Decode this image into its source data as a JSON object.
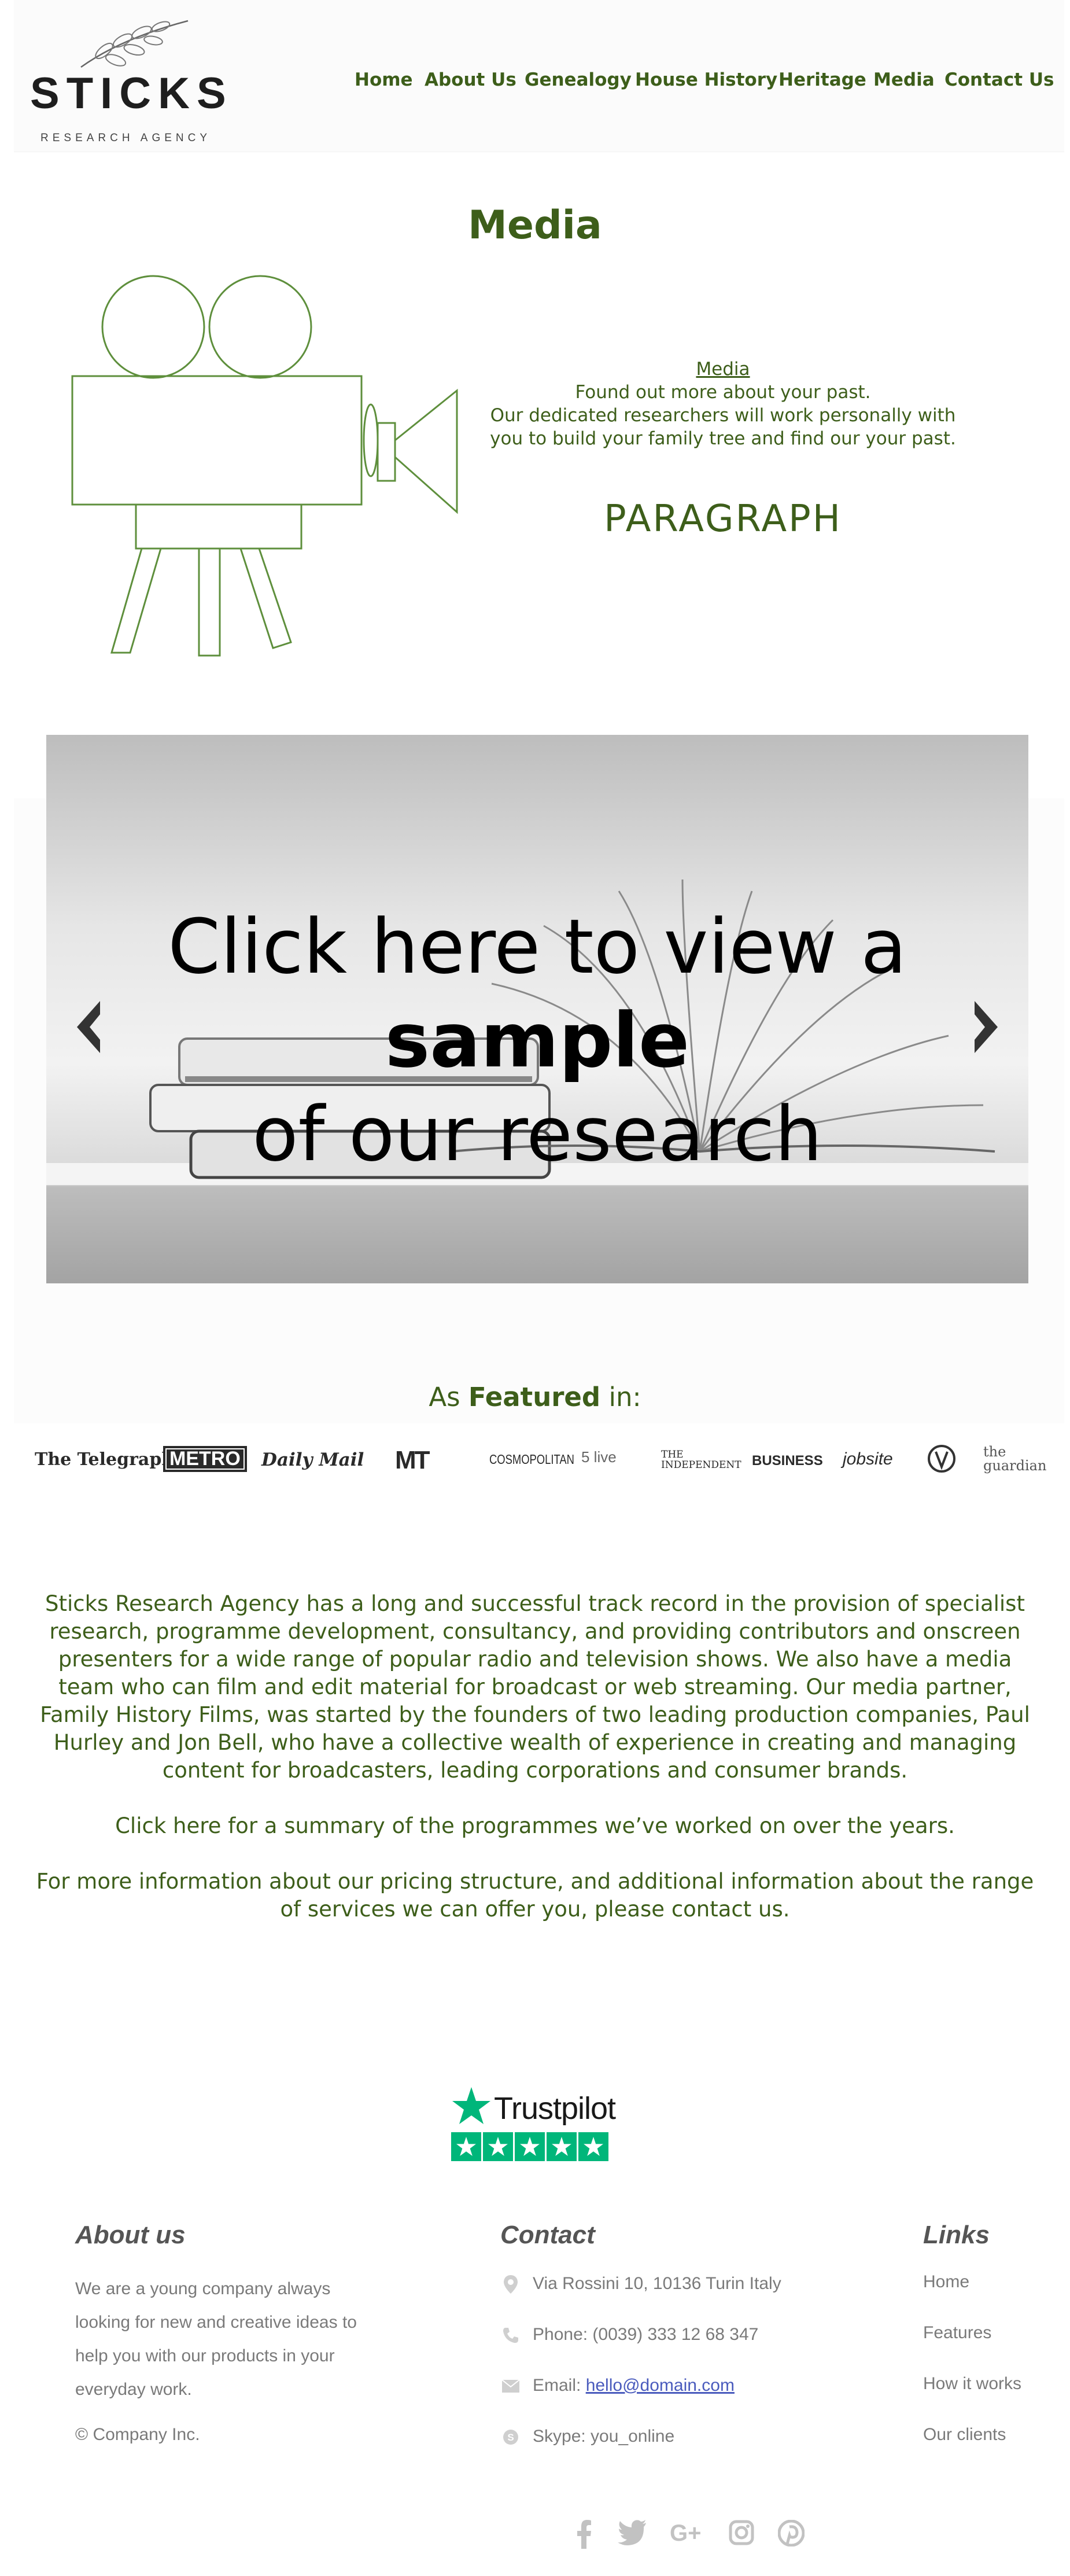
{
  "header": {
    "logo_word": "STICKS",
    "logo_sub": "RESEARCH AGENCY",
    "nav": [
      "Home",
      "About Us",
      "Genealogy",
      "House History",
      "Heritage",
      "Media",
      "Contact Us"
    ]
  },
  "media": {
    "title": "Media",
    "link": "Media",
    "lines": [
      "Found out more about your past.",
      "Our dedicated researchers will work personally with",
      "you to build your family tree and find our your past."
    ],
    "paragraph": "PARAGRAPH"
  },
  "slider": {
    "caption_normal": "Click here to view a ",
    "caption_bold": "sample",
    "caption_line2": "of our research"
  },
  "featured": {
    "prefix": "As ",
    "bold": "Featured",
    "suffix": " in:",
    "logos": [
      "The Telegraph",
      "METRO",
      "Daily Mail",
      "MT",
      "COSMOPOLITAN",
      "5 live",
      "THE INDEPENDENT",
      "BUSINESS",
      "jobsite",
      "the guardian"
    ]
  },
  "body": {
    "p1": "Sticks Research Agency has a long and successful track record in the provision of specialist research, programme development, consultancy, and providing contributors and onscreen presenters for a wide range of popular radio and television shows. We also have a media team who can film and edit material for broadcast or web streaming. Our media partner, Family History Films, was started by the founders of two leading production companies, Paul Hurley and Jon Bell, who have a collective wealth of experience in creating and managing content for broadcasters, leading corporations and consumer brands.",
    "p2": "Click here for a summary of the programmes we’ve worked on over the years.",
    "p3": "For more information about our pricing structure, and additional information about the range of services we can offer you, please contact us."
  },
  "trustpilot": {
    "label": "Trustpilot",
    "color": "#00b67a"
  },
  "footer": {
    "about_heading": "About us",
    "about_text": "We are a young company always looking for new and creative ideas to help you with our products in your everyday work.",
    "copyright": "© Company Inc.",
    "contact_heading": "Contact",
    "address": "Via Rossini 10, 10136 Turin Italy",
    "phone": "Phone: (0039) 333 12 68 347",
    "email_label": "Email: ",
    "email": "hello@domain.com",
    "skype": "Skype: you_online",
    "links_heading": "Links",
    "links": [
      "Home",
      "Features",
      "How it works",
      "Our clients"
    ],
    "social_icons": [
      "facebook-icon",
      "twitter-icon",
      "google-plus-icon",
      "instagram-icon",
      "pinterest-icon"
    ]
  }
}
